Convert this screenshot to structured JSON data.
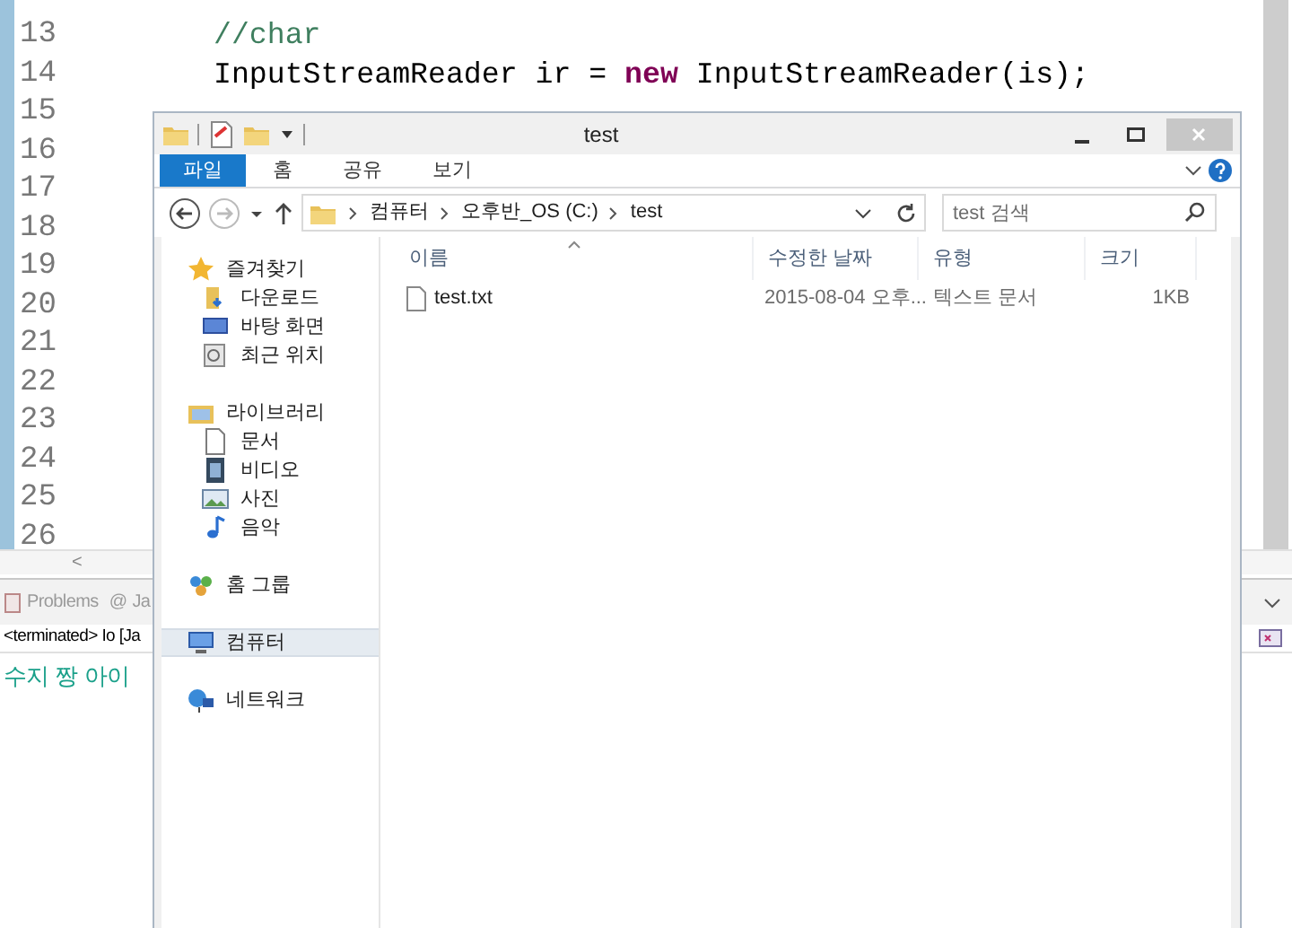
{
  "editor": {
    "lines": [
      {
        "number": "13",
        "segments": [
          {
            "kind": "comment",
            "text": "//char"
          }
        ]
      },
      {
        "number": "14",
        "segments": [
          {
            "kind": "plain",
            "text": "InputStreamReader ir = "
          },
          {
            "kind": "keyword",
            "text": "new"
          },
          {
            "kind": "plain",
            "text": " InputStreamReader(is);"
          }
        ]
      },
      {
        "number": "15"
      },
      {
        "number": "16"
      },
      {
        "number": "17"
      },
      {
        "number": "18"
      },
      {
        "number": "19"
      },
      {
        "number": "20"
      },
      {
        "number": "21"
      },
      {
        "number": "22"
      },
      {
        "number": "23"
      },
      {
        "number": "24"
      },
      {
        "number": "25"
      },
      {
        "number": "26"
      }
    ],
    "scroll_left": "<"
  },
  "console": {
    "tabs": [
      {
        "label": "Problems"
      },
      {
        "label": "Ja",
        "prefix": "@"
      }
    ],
    "status": "<terminated> Io [Ja",
    "output": "수지 짱 아이"
  },
  "explorer": {
    "title": "test",
    "ribbon_tabs": [
      {
        "label": "파일",
        "selected": true
      },
      {
        "label": "홈",
        "selected": false
      },
      {
        "label": "공유",
        "selected": false
      },
      {
        "label": "보기",
        "selected": false
      }
    ],
    "breadcrumb": [
      "컴퓨터",
      "오후반_OS (C:)",
      "test"
    ],
    "search": {
      "placeholder": "test 검색"
    },
    "nav": [
      {
        "label": "즐겨찾기",
        "selected": false,
        "children": [
          {
            "label": "다운로드",
            "selected": false
          },
          {
            "label": "바탕 화면",
            "selected": false
          },
          {
            "label": "최근 위치",
            "selected": false
          }
        ]
      },
      {
        "label": "라이브러리",
        "selected": false,
        "children": [
          {
            "label": "문서",
            "selected": false
          },
          {
            "label": "비디오",
            "selected": false
          },
          {
            "label": "사진",
            "selected": false
          },
          {
            "label": "음악",
            "selected": false
          }
        ]
      },
      {
        "label": "홈 그룹",
        "selected": false
      },
      {
        "label": "컴퓨터",
        "selected": true
      },
      {
        "label": "네트워크",
        "selected": false
      }
    ],
    "columns": [
      "이름",
      "수정한 날짜",
      "유형",
      "크기"
    ],
    "files": [
      {
        "name": "test.txt",
        "modified": "2015-08-04 오후...",
        "type": "텍스트 문서",
        "size": "1KB"
      }
    ]
  }
}
